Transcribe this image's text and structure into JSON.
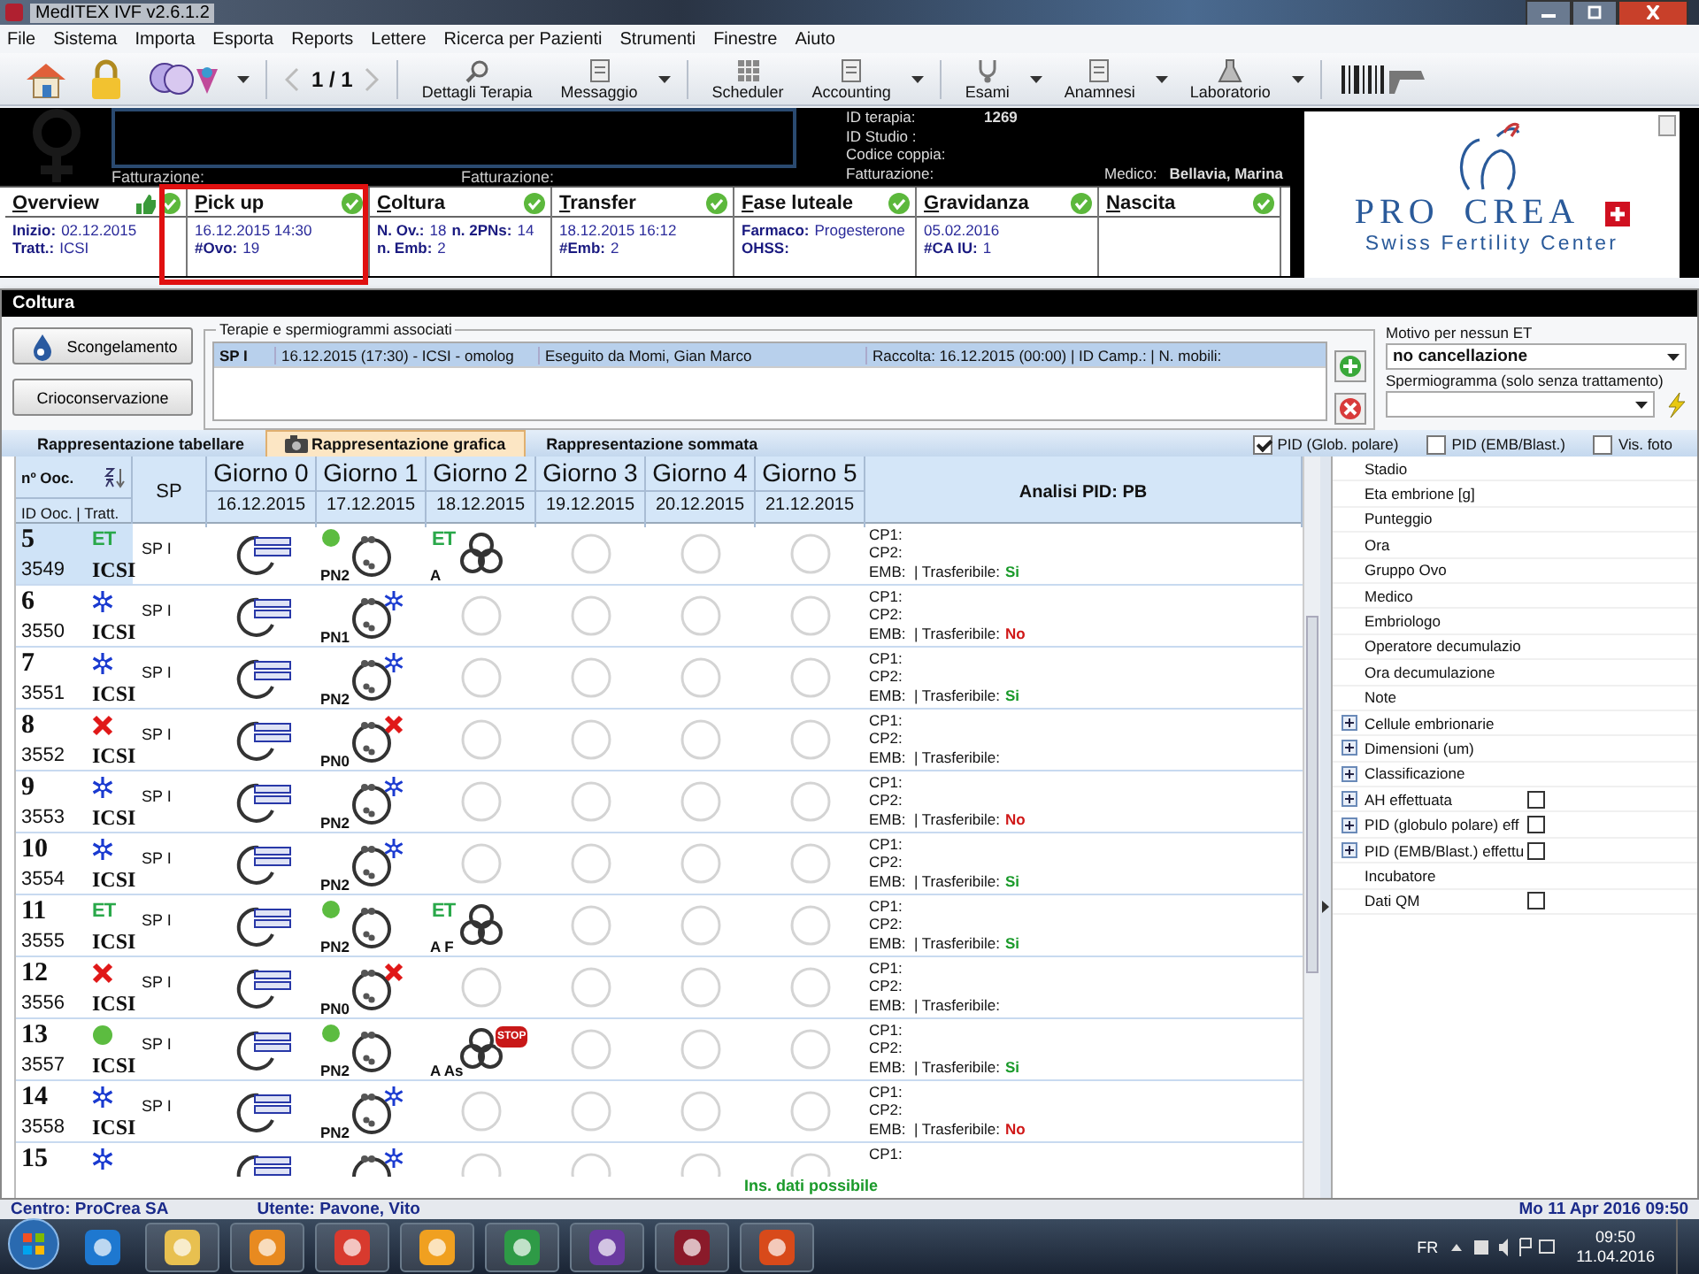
{
  "window": {
    "title": "MedITEX IVF v2.6.1.2"
  },
  "menu": [
    "File",
    "Sistema",
    "Importa",
    "Esporta",
    "Reports",
    "Lettere",
    "Ricerca per Pazienti",
    "Strumenti",
    "Finestre",
    "Aiuto"
  ],
  "toolbar": {
    "pager": "1 / 1",
    "buttons": [
      {
        "label": "Dettagli Terapia",
        "dropdown": false
      },
      {
        "label": "Messaggio",
        "dropdown": true
      },
      {
        "label": "Scheduler",
        "dropdown": false
      },
      {
        "label": "Accounting",
        "dropdown": true
      },
      {
        "label": "Esami",
        "dropdown": true
      },
      {
        "label": "Anamnesi",
        "dropdown": true
      },
      {
        "label": "Laboratorio",
        "dropdown": true
      }
    ]
  },
  "header": {
    "billing_labels": [
      "Fatturazione:",
      "Fatturazione:"
    ],
    "info": [
      {
        "label": "ID terapia:",
        "value": "1269"
      },
      {
        "label": "ID Studio :"
      },
      {
        "label": "Codice coppia:"
      },
      {
        "label": "Fatturazione:"
      }
    ],
    "doctor": {
      "label": "Medico:",
      "value": "Bellavia, Marina"
    }
  },
  "logo": {
    "name_left": "PRO",
    "name_right": "CREA",
    "tagline": "Swiss Fertility Center"
  },
  "stages": [
    {
      "title": "Overview",
      "checked": true,
      "approved": true,
      "highlighted": false,
      "lines": [
        [
          {
            "label": "Inizio:",
            "value": "02.12.2015"
          }
        ],
        [
          {
            "label": "Tratt.:",
            "value": "ICSI"
          }
        ]
      ]
    },
    {
      "title": "Pick up",
      "checked": true,
      "approved": false,
      "highlighted": true,
      "lines": [
        [
          {
            "value": "16.12.2015 14:30"
          }
        ],
        [
          {
            "label": "#Ovo:",
            "value": "19"
          }
        ]
      ]
    },
    {
      "title": "Coltura",
      "checked": true,
      "approved": false,
      "highlighted": false,
      "lines": [
        [
          {
            "label": "N. Ov.:",
            "value": "18"
          },
          {
            "label": "n. 2PNs:",
            "value": "14"
          }
        ],
        [
          {
            "label": "n. Emb:",
            "value": "2"
          }
        ]
      ]
    },
    {
      "title": "Transfer",
      "checked": true,
      "approved": false,
      "highlighted": false,
      "lines": [
        [
          {
            "value": "18.12.2015 16:12"
          }
        ],
        [
          {
            "label": "#Emb:",
            "value": "2"
          }
        ]
      ]
    },
    {
      "title": "Fase luteale",
      "checked": true,
      "approved": false,
      "highlighted": false,
      "lines": [
        [
          {
            "label": "Farmaco:",
            "value": "Progesterone"
          }
        ],
        [
          {
            "label": "OHSS:"
          }
        ]
      ]
    },
    {
      "title": "Gravidanza",
      "checked": true,
      "approved": false,
      "highlighted": false,
      "lines": [
        [
          {
            "value": "05.02.2016"
          }
        ],
        [
          {
            "label": "#CA IU:",
            "value": "1"
          }
        ]
      ]
    },
    {
      "title": "Nascita",
      "checked": true,
      "approved": false,
      "highlighted": false
    }
  ],
  "culture": {
    "title": "Coltura",
    "buttons": [
      "Scongelamento",
      "Crioconservazione"
    ],
    "therapies": {
      "legend": "Terapie e spermiogrammi associati",
      "rows": [
        {
          "selected": true,
          "cells": [
            "SP I",
            "16.12.2015 (17:30) - ICSI - omolog",
            "Eseguito da Momi, Gian Marco",
            "Raccolta: 16.12.2015 (00:00)  | ID Camp.:  | N. mobili:"
          ]
        }
      ]
    },
    "no_et_reason": {
      "label": "Motivo per nessun ET",
      "value": "no cancellazione"
    },
    "spermiogram": {
      "label": "Spermiogramma (solo senza trattamento)"
    },
    "tabs": [
      {
        "label": "Rappresentazione tabellare",
        "selected": false
      },
      {
        "label": "Rappresentazione grafica",
        "selected": true
      },
      {
        "label": "Rappresentazione sommata",
        "selected": false
      }
    ],
    "options": [
      {
        "label": "PID (Glob. polare)",
        "checked": true
      },
      {
        "label": "PID (EMB/Blast.)",
        "checked": false
      },
      {
        "label": "Vis. foto",
        "checked": false
      }
    ],
    "table": {
      "head_num": "nº Ooc.",
      "head_id": "ID Ooc. | Tratt.",
      "head_sp": "SP",
      "head_analysis": "Analisi PID: PB",
      "days": [
        {
          "label": "Giorno 0",
          "date": "16.12.2015"
        },
        {
          "label": "Giorno 1",
          "date": "17.12.2015"
        },
        {
          "label": "Giorno 2",
          "date": "18.12.2015"
        },
        {
          "label": "Giorno 3",
          "date": "19.12.2015"
        },
        {
          "label": "Giorno 4",
          "date": "20.12.2015"
        },
        {
          "label": "Giorno 5",
          "date": "21.12.2015"
        }
      ],
      "rows": [
        {
          "num": "5",
          "id": "3549",
          "status": {
            "kind": "et",
            "text": "ET"
          },
          "tratt": "ICSI",
          "sp": "SP I",
          "selected": true,
          "days": [
            {
              "kind": "oocyte"
            },
            {
              "kind": "zygote",
              "marker": {
                "kind": "dot"
              },
              "label": "PN2"
            },
            {
              "kind": "embryo",
              "marker": {
                "kind": "et",
                "text": "ET"
              },
              "label": "A"
            },
            {
              "kind": "empty"
            },
            {
              "kind": "empty"
            },
            {
              "kind": "empty"
            }
          ],
          "analysis": [
            "CP1:",
            "CP2:",
            "EMB:  | Trasferibile:"
          ],
          "transferable": "Si",
          "transferable_ok": true
        },
        {
          "num": "6",
          "id": "3550",
          "status": {
            "kind": "frozen"
          },
          "tratt": "ICSI",
          "sp": "SP I",
          "selected": false,
          "days": [
            {
              "kind": "oocyte"
            },
            {
              "kind": "zygote",
              "marker": {
                "kind": "frozen"
              },
              "label": "PN1"
            },
            {
              "kind": "empty"
            },
            {
              "kind": "empty"
            },
            {
              "kind": "empty"
            },
            {
              "kind": "empty"
            }
          ],
          "analysis": [
            "CP1:",
            "CP2:",
            "EMB:  | Trasferibile:"
          ],
          "transferable": "No",
          "transferable_ok": false
        },
        {
          "num": "7",
          "id": "3551",
          "status": {
            "kind": "frozen"
          },
          "tratt": "ICSI",
          "sp": "SP I",
          "selected": false,
          "days": [
            {
              "kind": "oocyte"
            },
            {
              "kind": "zygote",
              "marker": {
                "kind": "frozen"
              },
              "label": "PN2"
            },
            {
              "kind": "empty"
            },
            {
              "kind": "empty"
            },
            {
              "kind": "empty"
            },
            {
              "kind": "empty"
            }
          ],
          "analysis": [
            "CP1:",
            "CP2:",
            "EMB:  | Trasferibile:"
          ],
          "transferable": "Si",
          "transferable_ok": true
        },
        {
          "num": "8",
          "id": "3552",
          "status": {
            "kind": "discarded"
          },
          "tratt": "ICSI",
          "sp": "SP I",
          "selected": false,
          "days": [
            {
              "kind": "oocyte"
            },
            {
              "kind": "zygote",
              "marker": {
                "kind": "discarded"
              },
              "label": "PN0"
            },
            {
              "kind": "empty"
            },
            {
              "kind": "empty"
            },
            {
              "kind": "empty"
            },
            {
              "kind": "empty"
            }
          ],
          "analysis": [
            "CP1:",
            "CP2:",
            "EMB:  | Trasferibile:"
          ]
        },
        {
          "num": "9",
          "id": "3553",
          "status": {
            "kind": "frozen"
          },
          "tratt": "ICSI",
          "sp": "SP I",
          "selected": false,
          "days": [
            {
              "kind": "oocyte"
            },
            {
              "kind": "zygote",
              "marker": {
                "kind": "frozen"
              },
              "label": "PN2"
            },
            {
              "kind": "empty"
            },
            {
              "kind": "empty"
            },
            {
              "kind": "empty"
            },
            {
              "kind": "empty"
            }
          ],
          "analysis": [
            "CP1:",
            "CP2:",
            "EMB:  | Trasferibile:"
          ],
          "transferable": "No",
          "transferable_ok": false
        },
        {
          "num": "10",
          "id": "3554",
          "status": {
            "kind": "frozen"
          },
          "tratt": "ICSI",
          "sp": "SP I",
          "selected": false,
          "days": [
            {
              "kind": "oocyte"
            },
            {
              "kind": "zygote",
              "marker": {
                "kind": "frozen"
              },
              "label": "PN2"
            },
            {
              "kind": "empty"
            },
            {
              "kind": "empty"
            },
            {
              "kind": "empty"
            },
            {
              "kind": "empty"
            }
          ],
          "analysis": [
            "CP1:",
            "CP2:",
            "EMB:  | Trasferibile:"
          ],
          "transferable": "Si",
          "transferable_ok": true
        },
        {
          "num": "11",
          "id": "3555",
          "status": {
            "kind": "et",
            "text": "ET"
          },
          "tratt": "ICSI",
          "sp": "SP I",
          "selected": false,
          "days": [
            {
              "kind": "oocyte"
            },
            {
              "kind": "zygote",
              "marker": {
                "kind": "dot"
              },
              "label": "PN2"
            },
            {
              "kind": "embryo",
              "marker": {
                "kind": "et",
                "text": "ET"
              },
              "label": "A F"
            },
            {
              "kind": "empty"
            },
            {
              "kind": "empty"
            },
            {
              "kind": "empty"
            }
          ],
          "analysis": [
            "CP1:",
            "CP2:",
            "EMB:  | Trasferibile:"
          ],
          "transferable": "Si",
          "transferable_ok": true
        },
        {
          "num": "12",
          "id": "3556",
          "status": {
            "kind": "discarded"
          },
          "tratt": "ICSI",
          "sp": "SP I",
          "selected": false,
          "days": [
            {
              "kind": "oocyte"
            },
            {
              "kind": "zygote",
              "marker": {
                "kind": "discarded"
              },
              "label": "PN0"
            },
            {
              "kind": "empty"
            },
            {
              "kind": "empty"
            },
            {
              "kind": "empty"
            },
            {
              "kind": "empty"
            }
          ],
          "analysis": [
            "CP1:",
            "CP2:",
            "EMB:  | Trasferibile:"
          ]
        },
        {
          "num": "13",
          "id": "3557",
          "status": {
            "kind": "dot"
          },
          "tratt": "ICSI",
          "sp": "SP I",
          "selected": false,
          "days": [
            {
              "kind": "oocyte"
            },
            {
              "kind": "zygote",
              "marker": {
                "kind": "dot"
              },
              "label": "PN2"
            },
            {
              "kind": "embryo",
              "marker": {
                "kind": "stop",
                "text": "STOP"
              },
              "label": "A As"
            },
            {
              "kind": "empty"
            },
            {
              "kind": "empty"
            },
            {
              "kind": "empty"
            }
          ],
          "analysis": [
            "CP1:",
            "CP2:",
            "EMB:  | Trasferibile:"
          ],
          "transferable": "Si",
          "transferable_ok": true
        },
        {
          "num": "14",
          "id": "3558",
          "status": {
            "kind": "frozen"
          },
          "tratt": "ICSI",
          "sp": "SP I",
          "selected": false,
          "days": [
            {
              "kind": "oocyte"
            },
            {
              "kind": "zygote",
              "marker": {
                "kind": "frozen"
              },
              "label": "PN2"
            },
            {
              "kind": "empty"
            },
            {
              "kind": "empty"
            },
            {
              "kind": "empty"
            },
            {
              "kind": "empty"
            }
          ],
          "analysis": [
            "CP1:",
            "CP2:",
            "EMB:  | Trasferibile:"
          ],
          "transferable": "No",
          "transferable_ok": false
        },
        {
          "num": "15",
          "status": {
            "kind": "frozen"
          },
          "selected": false,
          "days": [
            {
              "kind": "oocyte"
            },
            {
              "kind": "zygote",
              "marker": {
                "kind": "frozen"
              }
            },
            {
              "kind": "empty"
            },
            {
              "kind": "empty"
            },
            {
              "kind": "empty"
            },
            {
              "kind": "empty"
            }
          ],
          "analysis": [
            "CP1:"
          ]
        }
      ],
      "footer": "Ins. dati possibile"
    },
    "properties": [
      {
        "label": "Stadio",
        "expandable": false
      },
      {
        "label": "Eta embrione [g]",
        "expandable": false
      },
      {
        "label": "Punteggio",
        "expandable": false
      },
      {
        "label": "Ora",
        "expandable": false
      },
      {
        "label": "Gruppo Ovo",
        "expandable": false
      },
      {
        "label": "Medico",
        "expandable": false
      },
      {
        "label": "Embriologo",
        "expandable": false
      },
      {
        "label": "Operatore decumulazio",
        "expandable": false
      },
      {
        "label": "Ora decumulazione",
        "expandable": false
      },
      {
        "label": "Note",
        "expandable": false
      },
      {
        "label": "Cellule embrionarie",
        "expandable": true
      },
      {
        "label": "Dimensioni (um)",
        "expandable": true
      },
      {
        "label": "Classificazione",
        "expandable": true
      },
      {
        "label": "AH effettuata",
        "expandable": true,
        "checked": false
      },
      {
        "label": "PID (globulo polare) eff",
        "expandable": true,
        "checked": false
      },
      {
        "label": "PID (EMB/Blast.) effettu",
        "expandable": true,
        "checked": false
      },
      {
        "label": "Incubatore",
        "expandable": false
      },
      {
        "label": "Dati QM",
        "expandable": false,
        "checked": false
      }
    ]
  },
  "status_bar": {
    "centre": "Centro: ProCrea SA",
    "user": "Utente: Pavone, Vito",
    "datetime": "Mo 11 Apr 2016 09:50"
  },
  "taskbar": {
    "language": "FR",
    "time": "09:50",
    "date": "11.04.2016"
  }
}
